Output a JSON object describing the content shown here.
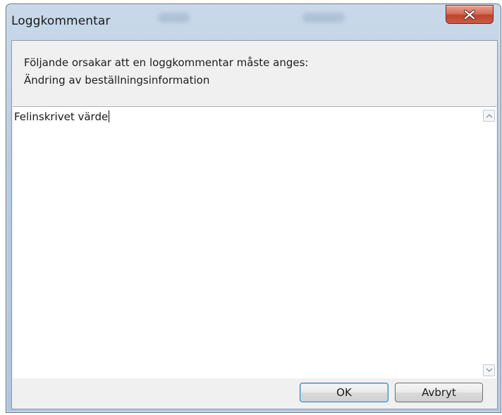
{
  "window": {
    "title": "Loggkommentar"
  },
  "message": {
    "line1": "Följande orsakar att en loggkommentar måste anges:",
    "line2": "Ändring av beställningsinformation"
  },
  "comment": {
    "value": "Felinskrivet värde"
  },
  "buttons": {
    "ok": "OK",
    "cancel": "Avbryt"
  },
  "icons": {
    "close": "close-icon",
    "scroll_up": "chevron-up-icon",
    "scroll_down": "chevron-down-icon"
  },
  "colors": {
    "titlebar": "#b7cbe0",
    "close_button": "#c1432f",
    "panel": "#f0f0f0",
    "default_button_border": "#3c7fb1"
  }
}
